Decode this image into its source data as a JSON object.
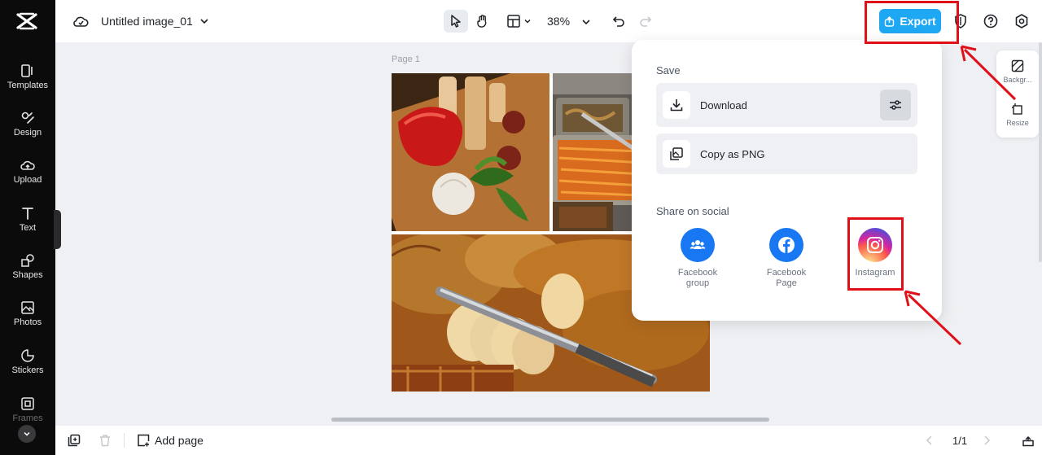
{
  "app": {
    "document_title": "Untitled image_01",
    "zoom": "38%",
    "page_label": "Page 1"
  },
  "sidebar": {
    "items": [
      {
        "label": "Templates",
        "icon": "templates-icon"
      },
      {
        "label": "Design",
        "icon": "design-icon"
      },
      {
        "label": "Upload",
        "icon": "upload-icon"
      },
      {
        "label": "Text",
        "icon": "text-icon"
      },
      {
        "label": "Shapes",
        "icon": "shapes-icon"
      },
      {
        "label": "Photos",
        "icon": "photos-icon"
      },
      {
        "label": "Stickers",
        "icon": "stickers-icon"
      },
      {
        "label": "Frames",
        "icon": "frames-icon"
      }
    ]
  },
  "toolbar": {
    "export_label": "Export"
  },
  "right_panel": {
    "items": [
      {
        "label": "Backgr...",
        "icon": "background-icon"
      },
      {
        "label": "Resize",
        "icon": "resize-icon"
      }
    ]
  },
  "export_popover": {
    "save_heading": "Save",
    "download_label": "Download",
    "copy_label": "Copy as PNG",
    "share_heading": "Share on social",
    "social": [
      {
        "line1": "Facebook",
        "line2": "group",
        "icon": "facebook-group-icon",
        "color": "#1877f2"
      },
      {
        "line1": "Facebook",
        "line2": "Page",
        "icon": "facebook-icon",
        "color": "#1877f2"
      },
      {
        "line1": "Instagram",
        "line2": "",
        "icon": "instagram-icon",
        "color": "#e1306c"
      }
    ]
  },
  "bottombar": {
    "add_page_label": "Add page",
    "page_indicator": "1/1"
  },
  "colors": {
    "accent": "#1ea7f2",
    "highlight": "#e0101a"
  }
}
